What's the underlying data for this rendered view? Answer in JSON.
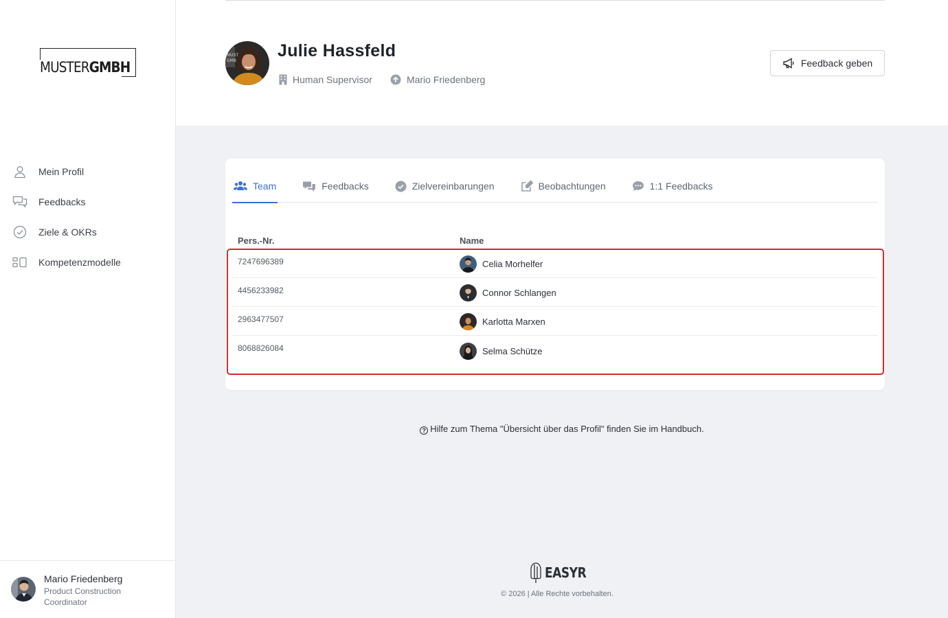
{
  "brand": {
    "logo_thin": "MUSTER",
    "logo_bold": "GMBH"
  },
  "sidebar": {
    "items": [
      {
        "label": "Mein Profil",
        "icon": "user-icon"
      },
      {
        "label": "Feedbacks",
        "icon": "chat-icon"
      },
      {
        "label": "Ziele & OKRs",
        "icon": "check-circle-icon"
      },
      {
        "label": "Kompetenzmodelle",
        "icon": "model-icon"
      }
    ],
    "user": {
      "name": "Mario Friedenberg",
      "role": "Product Construction Coordinator"
    }
  },
  "profile": {
    "name": "Julie Hassfeld",
    "role": "Human Supervisor",
    "supervisor": "Mario Friedenberg",
    "feedback_button": "Feedback geben"
  },
  "tabs": [
    {
      "label": "Team",
      "icon": "users-icon",
      "active": true
    },
    {
      "label": "Feedbacks",
      "icon": "comments-icon",
      "active": false
    },
    {
      "label": "Zielvereinbarungen",
      "icon": "check-circle-icon",
      "active": false
    },
    {
      "label": "Beobachtungen",
      "icon": "edit-icon",
      "active": false
    },
    {
      "label": "1:1 Feedbacks",
      "icon": "comment-dots-icon",
      "active": false
    }
  ],
  "table": {
    "headers": {
      "number": "Pers.-Nr.",
      "name": "Name"
    },
    "rows": [
      {
        "number": "7247696389",
        "name": "Celia Morhelfer"
      },
      {
        "number": "4456233982",
        "name": "Connor Schlangen"
      },
      {
        "number": "2963477507",
        "name": "Karlotta Marxen"
      },
      {
        "number": "8068826084",
        "name": "Selma Schütze"
      }
    ]
  },
  "help": {
    "text": "Hilfe zum Thema \"Übersicht über das Profil\" finden Sie im Handbuch."
  },
  "footer": {
    "logo": "EASYR",
    "copyright": "© 2026 | Alle Rechte vorbehalten."
  },
  "colors": {
    "accent": "#3b6fd4",
    "highlight": "#d42a2a",
    "background": "#eff1f4"
  }
}
